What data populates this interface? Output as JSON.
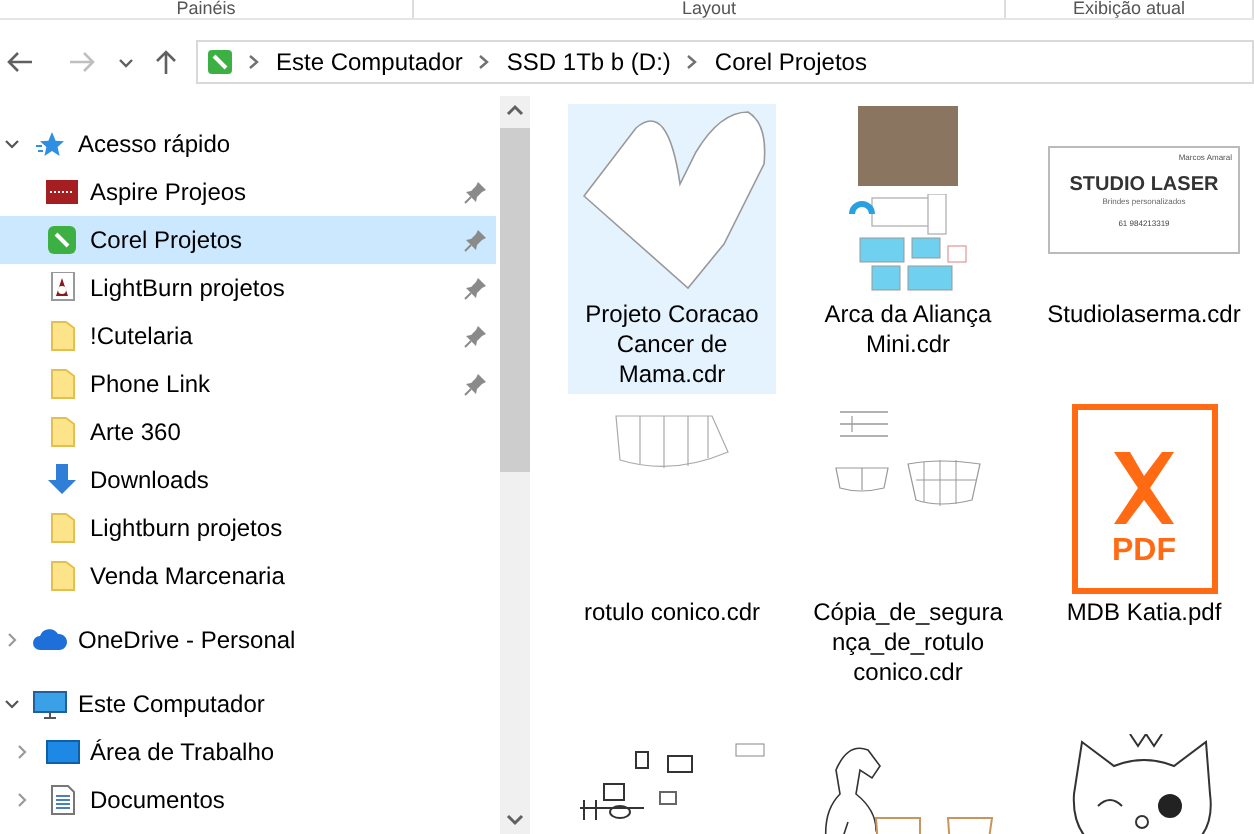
{
  "ribbon_groups": [
    "Painéis",
    "Layout",
    "Exibição atual"
  ],
  "address_bar": {
    "back_disabled": false,
    "forward_disabled": true,
    "path": [
      "Este Computador",
      "SSD 1Tb b (D:)",
      "Corel Projetos"
    ]
  },
  "navigation": [
    {
      "label": "Acesso rápido",
      "kind": "star",
      "expanded": true,
      "children": [
        {
          "label": "Aspire Projeos",
          "kind": "app-red",
          "pinned": true,
          "selected": false
        },
        {
          "label": "Corel Projetos",
          "kind": "corel",
          "pinned": true,
          "selected": true
        },
        {
          "label": "LightBurn projetos",
          "kind": "lightburn",
          "pinned": true,
          "selected": false
        },
        {
          "label": "!Cutelaria",
          "kind": "folder",
          "pinned": true,
          "selected": false
        },
        {
          "label": "Phone Link",
          "kind": "folder",
          "pinned": true,
          "selected": false
        },
        {
          "label": "Arte 360",
          "kind": "folder",
          "pinned": false,
          "selected": false
        },
        {
          "label": "Downloads",
          "kind": "download",
          "pinned": false,
          "selected": false
        },
        {
          "label": "Lightburn projetos",
          "kind": "folder",
          "pinned": false,
          "selected": false
        },
        {
          "label": "Venda Marcenaria",
          "kind": "folder",
          "pinned": false,
          "selected": false
        }
      ]
    },
    {
      "label": "OneDrive - Personal",
      "kind": "cloud",
      "expanded": false
    },
    {
      "label": "Este Computador",
      "kind": "computer",
      "expanded": true,
      "children": [
        {
          "label": "Área de Trabalho",
          "kind": "desktop",
          "expanded": false,
          "selected": false
        },
        {
          "label": "Documentos",
          "kind": "document",
          "expanded": false,
          "selected": false
        }
      ]
    }
  ],
  "files": [
    {
      "name": "Projeto Coracao Cancer de Mama.cdr",
      "kind": "heart",
      "selected": true
    },
    {
      "name": "Arca da Aliança Mini.cdr",
      "kind": "photo-layout",
      "selected": false
    },
    {
      "name": "Studiolaserma.cdr",
      "kind": "card",
      "selected": false,
      "card_text": [
        "Marcos Amaral",
        "STUDIO LASER",
        "Brindes personalizados",
        "61 984213319"
      ]
    },
    {
      "name": "rotulo conico.cdr",
      "kind": "label",
      "selected": false
    },
    {
      "name": "Cópia_de_segurança_de_rotulo conico.cdr",
      "kind": "label-copy",
      "selected": false
    },
    {
      "name": "MDB Katia.pdf",
      "kind": "pdf",
      "selected": false,
      "badge": "PDF"
    },
    {
      "kind": "parts",
      "selected": false
    },
    {
      "kind": "horse",
      "selected": false
    },
    {
      "kind": "cat",
      "selected": false
    }
  ]
}
